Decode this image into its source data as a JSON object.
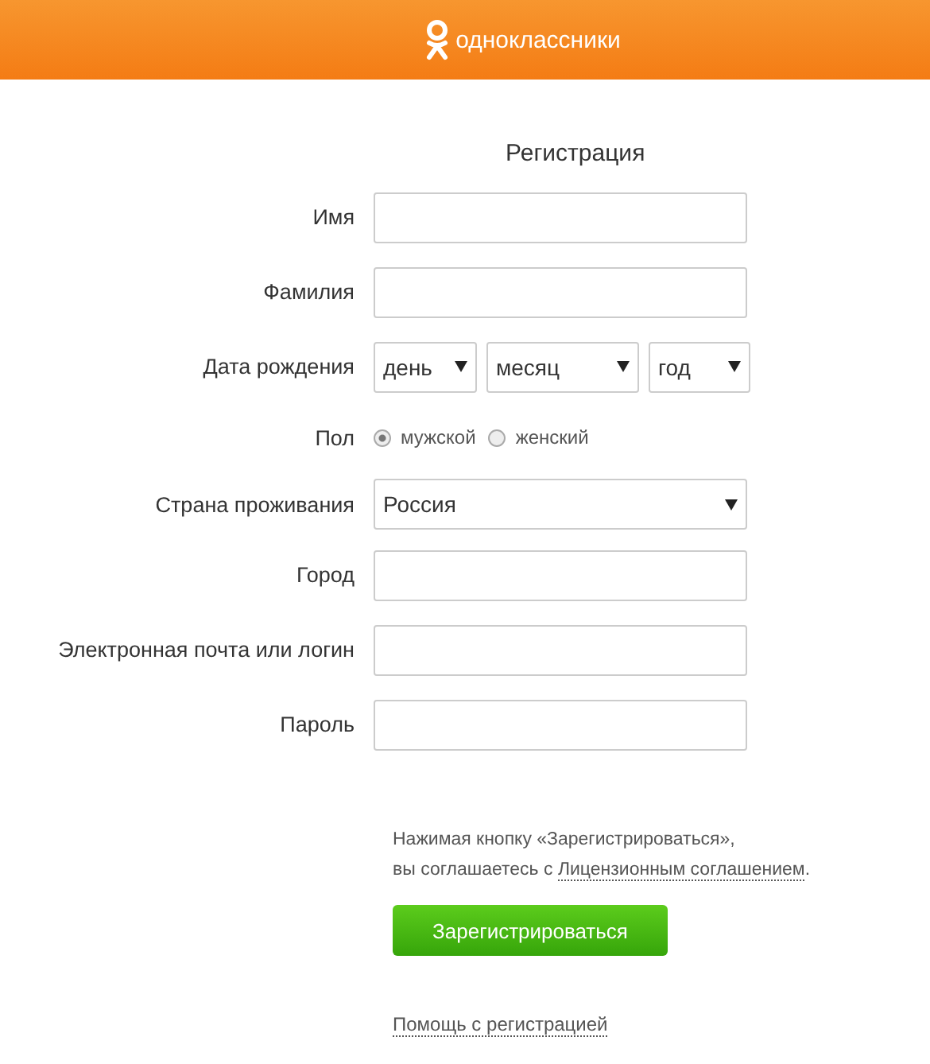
{
  "header": {
    "brand": "одноклассники"
  },
  "title": "Регистрация",
  "fields": [
    {
      "kind": "text",
      "label": "Имя"
    },
    {
      "kind": "text",
      "label": "Фамилия"
    },
    {
      "kind": "date",
      "label": "Дата рождения",
      "selects": [
        {
          "value": "день"
        },
        {
          "value": "месяц"
        },
        {
          "value": "год"
        }
      ]
    },
    {
      "kind": "radio",
      "label": "Пол",
      "options": [
        {
          "label": "мужской",
          "selected": true
        },
        {
          "label": "женский",
          "selected": false
        }
      ]
    },
    {
      "kind": "select",
      "label": "Страна проживания",
      "value": "Россия"
    },
    {
      "kind": "text",
      "label": "Город"
    },
    {
      "kind": "text",
      "label": "Электронная почта или логин"
    },
    {
      "kind": "password",
      "label": "Пароль"
    }
  ],
  "agreement": {
    "line_1": "Нажимая кнопку «Зарегистрироваться»,",
    "line_2": "вы соглашаетесь с ",
    "link": "Лицензионным соглашением",
    "after": "."
  },
  "submit": "Зарегистрироваться",
  "help_link": "Помощь с регистрацией"
}
